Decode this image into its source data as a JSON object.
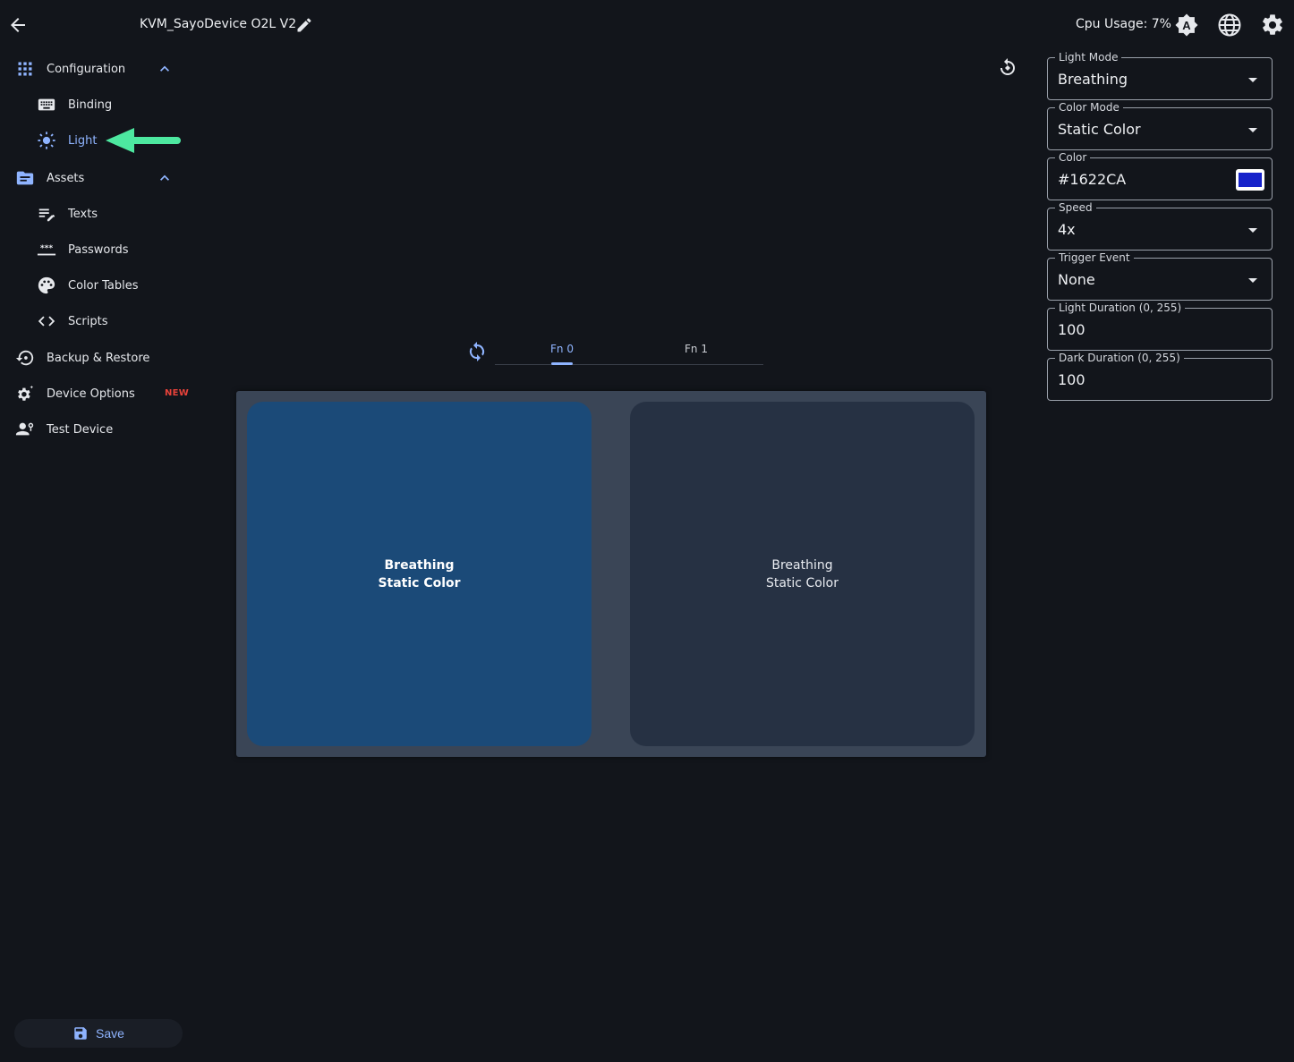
{
  "header": {
    "device_name": "KVM_SayoDevice O2L V2",
    "cpu_usage": "Cpu Usage: 7%"
  },
  "sidebar": {
    "configuration": {
      "label": "Configuration",
      "items": [
        {
          "label": "Binding",
          "icon": "keyboard-icon"
        },
        {
          "label": "Light",
          "icon": "brightness-icon",
          "active": true
        }
      ]
    },
    "assets": {
      "label": "Assets",
      "items": [
        {
          "label": "Texts",
          "icon": "text-edit-icon"
        },
        {
          "label": "Passwords",
          "icon": "password-icon"
        },
        {
          "label": "Color Tables",
          "icon": "palette-icon"
        },
        {
          "label": "Scripts",
          "icon": "code-icon"
        }
      ]
    },
    "backup_restore": {
      "label": "Backup & Restore"
    },
    "device_options": {
      "label": "Device Options",
      "badge": "NEW"
    },
    "test_device": {
      "label": "Test Device"
    },
    "save_label": "Save"
  },
  "tabs": [
    {
      "label": "Fn 0",
      "active": true
    },
    {
      "label": "Fn 1",
      "active": false
    }
  ],
  "keys": [
    {
      "line1": "Breathing",
      "line2": "Static Color",
      "selected": true
    },
    {
      "line1": "Breathing",
      "line2": "Static Color",
      "selected": false
    }
  ],
  "form": {
    "light_mode": {
      "label": "Light Mode",
      "value": "Breathing"
    },
    "color_mode": {
      "label": "Color Mode",
      "value": "Static Color"
    },
    "color": {
      "label": "Color",
      "value": "#1622CA"
    },
    "speed": {
      "label": "Speed",
      "value": "4x"
    },
    "trigger_event": {
      "label": "Trigger Event",
      "value": "None"
    },
    "light_duration": {
      "label": "Light Duration (0, 255)",
      "value": "100"
    },
    "dark_duration": {
      "label": "Dark Duration (0, 255)",
      "value": "100"
    }
  },
  "colors": {
    "accent": "#8fb4ff",
    "selected_key": "#1b4a78",
    "key": "#263143",
    "annotation_arrow": "#4de8a0",
    "new_badge": "#e8423a"
  }
}
